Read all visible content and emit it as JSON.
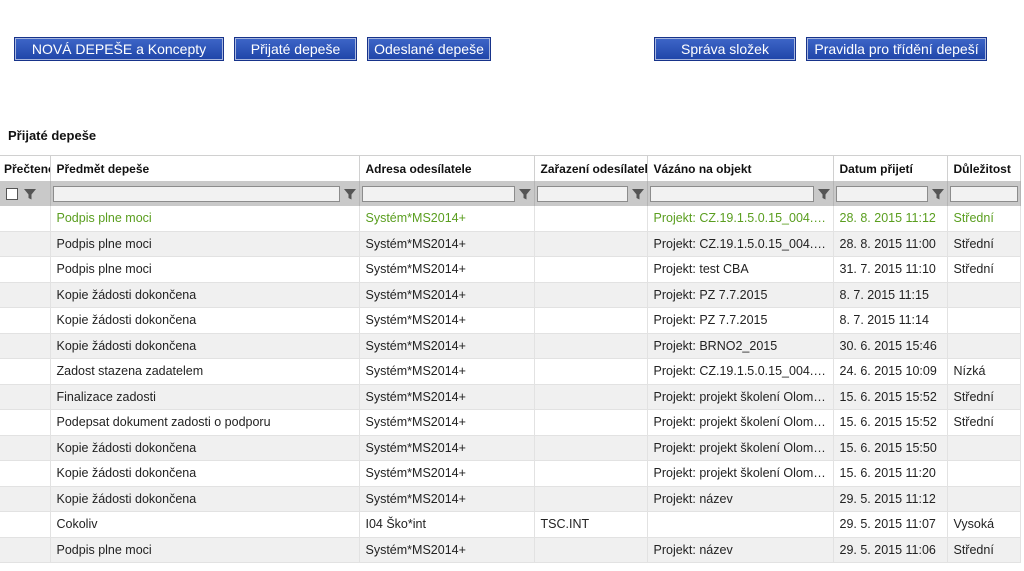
{
  "toolbar": {
    "new_label": "NOVÁ DEPEŠE a Koncepty",
    "received_label": "Přijaté depeše",
    "sent_label": "Odeslané depeše",
    "folders_label": "Správa složek",
    "rules_label": "Pravidla pro třídění depeší"
  },
  "section_title": "Přijaté depeše",
  "table": {
    "columns": [
      "Přečteno",
      "Předmět depeše",
      "Adresa odesílatele",
      "Zařazení odesílatele",
      "Vázáno na objekt",
      "Datum přijetí",
      "Důležitost"
    ],
    "rows": [
      {
        "subject": "Podpis plne moci",
        "sender": "Systém*MS2014+",
        "category": "",
        "object": "Projekt: CZ.19.1.5.0.15_004.00...",
        "date": "28. 8. 2015 11:12",
        "priority": "Střední",
        "unread": true
      },
      {
        "subject": "Podpis plne moci",
        "sender": "Systém*MS2014+",
        "category": "",
        "object": "Projekt: CZ.19.1.5.0.15_004.00...",
        "date": "28. 8. 2015 11:00",
        "priority": "Střední",
        "unread": false
      },
      {
        "subject": "Podpis plne moci",
        "sender": "Systém*MS2014+",
        "category": "",
        "object": "Projekt: test CBA",
        "date": "31. 7. 2015 11:10",
        "priority": "Střední",
        "unread": false
      },
      {
        "subject": "Kopie žádosti dokončena",
        "sender": "Systém*MS2014+",
        "category": "",
        "object": "Projekt: PZ 7.7.2015",
        "date": "8. 7. 2015 11:15",
        "priority": "",
        "unread": false
      },
      {
        "subject": "Kopie žádosti dokončena",
        "sender": "Systém*MS2014+",
        "category": "",
        "object": "Projekt: PZ 7.7.2015",
        "date": "8. 7. 2015 11:14",
        "priority": "",
        "unread": false
      },
      {
        "subject": "Kopie žádosti dokončena",
        "sender": "Systém*MS2014+",
        "category": "",
        "object": "Projekt: BRNO2_2015",
        "date": "30. 6. 2015 15:46",
        "priority": "",
        "unread": false
      },
      {
        "subject": "Zadost stazena zadatelem",
        "sender": "Systém*MS2014+",
        "category": "",
        "object": "Projekt: CZ.19.1.5.0.15_004.00...",
        "date": "24. 6. 2015 10:09",
        "priority": "Nízká",
        "unread": false
      },
      {
        "subject": "Finalizace zadosti",
        "sender": "Systém*MS2014+",
        "category": "",
        "object": "Projekt: projekt školení Olomo...",
        "date": "15. 6. 2015 15:52",
        "priority": "Střední",
        "unread": false
      },
      {
        "subject": "Podepsat dokument zadosti o podporu",
        "sender": "Systém*MS2014+",
        "category": "",
        "object": "Projekt: projekt školení Olomo...",
        "date": "15. 6. 2015 15:52",
        "priority": "Střední",
        "unread": false
      },
      {
        "subject": "Kopie žádosti dokončena",
        "sender": "Systém*MS2014+",
        "category": "",
        "object": "Projekt: projekt školení Olomo...",
        "date": "15. 6. 2015 15:50",
        "priority": "",
        "unread": false
      },
      {
        "subject": "Kopie žádosti dokončena",
        "sender": "Systém*MS2014+",
        "category": "",
        "object": "Projekt: projekt školení Olomo...",
        "date": "15. 6. 2015 11:20",
        "priority": "",
        "unread": false
      },
      {
        "subject": "Kopie žádosti dokončena",
        "sender": "Systém*MS2014+",
        "category": "",
        "object": "Projekt: název",
        "date": "29. 5. 2015 11:12",
        "priority": "",
        "unread": false
      },
      {
        "subject": "Cokoliv",
        "sender": "I04 Ško*int",
        "category": "TSC.INT",
        "object": "",
        "date": "29. 5. 2015 11:07",
        "priority": "Vysoká",
        "unread": false
      },
      {
        "subject": "Podpis plne moci",
        "sender": "Systém*MS2014+",
        "category": "",
        "object": "Projekt: název",
        "date": "29. 5. 2015 11:06",
        "priority": "Střední",
        "unread": false
      }
    ]
  },
  "colors": {
    "button_blue": "#2a52b8",
    "unread_green": "#5a9e1f",
    "filter_bar": "#c9c9c9"
  },
  "icons": {
    "filter": "filter-funnel-icon"
  }
}
